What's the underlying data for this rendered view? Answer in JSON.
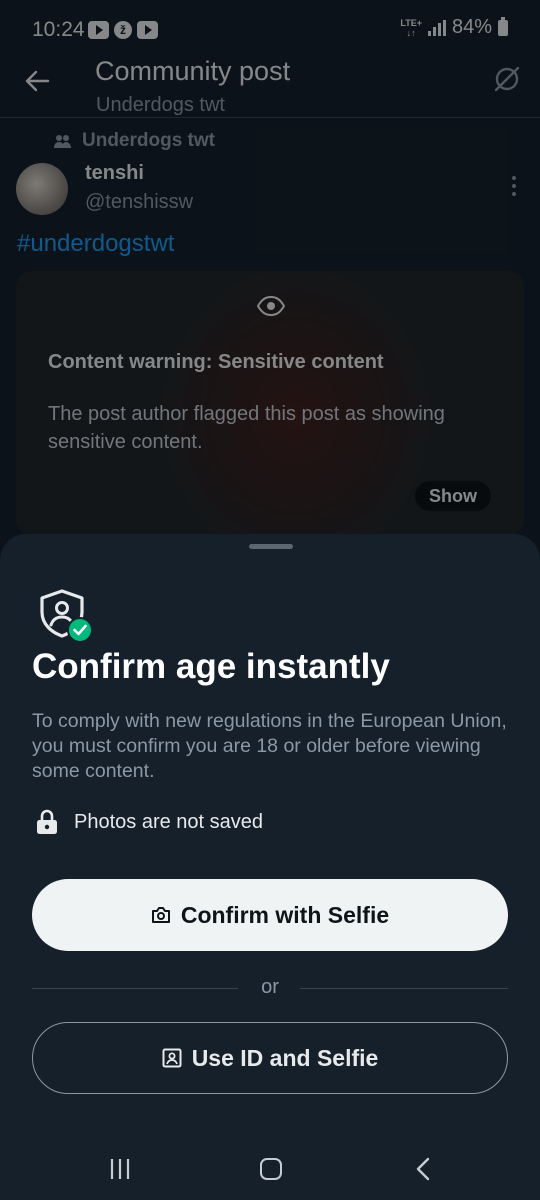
{
  "status_bar": {
    "time": "10:24",
    "network": "LTE+",
    "battery": "84%"
  },
  "header": {
    "title": "Community post",
    "subtitle": "Underdogs twt"
  },
  "post": {
    "community": "Underdogs twt",
    "author_name": "tenshi",
    "author_handle": "@tenshissw",
    "hashtag": "#underdogstwt",
    "content_warning": {
      "title": "Content warning: Sensitive content",
      "body": "The post author flagged this post as showing sensitive content.",
      "show_label": "Show"
    }
  },
  "sheet": {
    "title": "Confirm age instantly",
    "description": "To comply with new regulations in the European Union, you must confirm you are 18 or older before viewing some content.",
    "privacy_note": "Photos are not saved",
    "primary_button": "Confirm with Selfie",
    "divider_text": "or",
    "secondary_button": "Use ID and Selfie"
  },
  "colors": {
    "background": "#15202b",
    "accent": "#1d9bf0",
    "verified_green": "#00ba7c",
    "primary_button_bg": "#eff3f4"
  },
  "icons": [
    "back-arrow-icon",
    "no-symbol-icon",
    "community-icon",
    "more-icon",
    "eye-icon",
    "shield-user-icon",
    "check-icon",
    "lock-icon",
    "camera-icon",
    "id-card-icon"
  ]
}
